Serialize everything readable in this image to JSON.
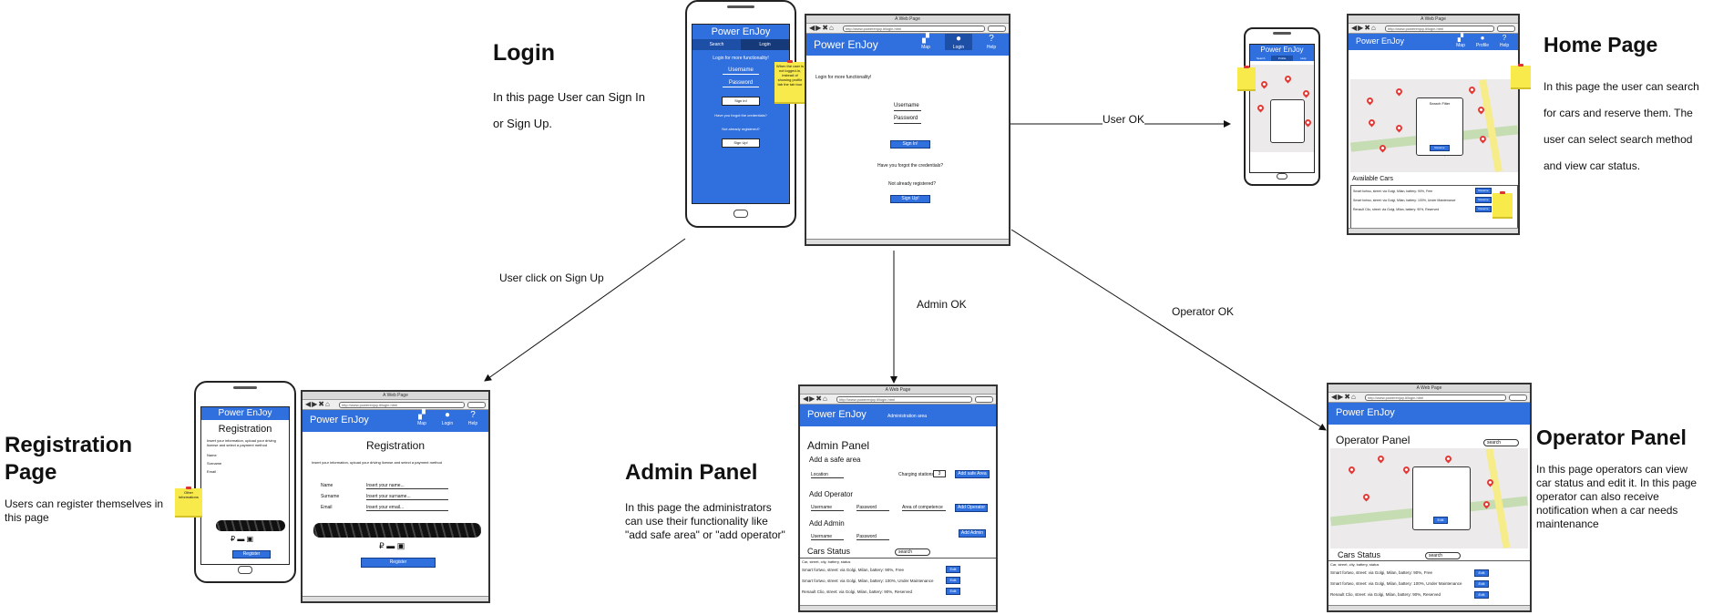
{
  "pages": {
    "login": {
      "title": "Login",
      "desc": "In this page User can Sign In or Sign Up."
    },
    "home": {
      "title": "Home Page",
      "desc": "In this page the user can search for cars and reserve them. The user can select search method and view car status."
    },
    "registration": {
      "title": "Registration Page",
      "desc": "Users can register themselves in this page"
    },
    "admin": {
      "title": "Admin Panel",
      "desc": "In this page the administrators can use their functionality like \"add safe area\" or \"add operator\""
    },
    "operator": {
      "title": "Operator Panel",
      "desc": "In this page operators can view car status and edit it. In this page operator can also receive notification when a car needs maintenance"
    }
  },
  "edges": {
    "user_ok": "User OK",
    "signup": "User click on Sign Up",
    "admin_ok": "Admin OK",
    "operator_ok": "Operator OK"
  },
  "mock": {
    "app_name": "Power EnJoy",
    "window_title": "A Web Page",
    "url": "http://www.powerenjoy.it/login.html",
    "nav": {
      "map": "Map",
      "login": "Login",
      "help": "Help",
      "profile": "Profile"
    },
    "phone_tabs": {
      "search": "Search",
      "login": "Login"
    },
    "login": {
      "prompt": "Login for more functionality!",
      "username": "Username",
      "password": "Password",
      "sign_in": "Sign In!",
      "forgot": "Have you forgot the credentials?",
      "not_registered": "Not already registered?",
      "sign_up": "Sign Up!",
      "note": "When the user is not logged-in, instead of showing profile tab the tab tour"
    },
    "registration": {
      "title": "Registration",
      "intro": "Insert your information, upload your driving license and select a payment method",
      "name": "Name",
      "surname": "Surname",
      "email": "Email",
      "name_ph": "Insert your name...",
      "surname_ph": "Insert your surname...",
      "email_ph": "Insert your email...",
      "button": "Register",
      "note": "Other informations"
    },
    "admin": {
      "subtitle": "Administration area",
      "title": "Admin Panel",
      "safe_area": "Add a safe area",
      "location": "Location",
      "charging": "Charging stations",
      "charging_val": "3",
      "add_safe": "Add safe Area",
      "add_operator": "Add Operator",
      "username": "Username",
      "password": "Password",
      "competence": "Area of competence",
      "add_op_btn": "Add Operator",
      "add_admin": "Add Admin",
      "add_admin_btn": "Add Admin",
      "cars_status": "Cars Status",
      "search": "search"
    },
    "operator": {
      "title": "Operator Panel",
      "cars_status": "Cars Status",
      "search": "search",
      "edit": "Edit"
    },
    "home": {
      "available_cars": "Available Cars",
      "reserve": "Reserve",
      "search_filter": "Search Filter",
      "status_header": "Car, street, city, battery, status"
    },
    "cars": [
      "Smart fortwo, street: via Golgi, Milan, battery: 90%, Free",
      "Smart fortwo, street: via Golgi, Milan, battery: 100%, Under Maintenance",
      "Renault Clio, street: via Golgi, Milan, battery: 90%, Reserved"
    ]
  }
}
